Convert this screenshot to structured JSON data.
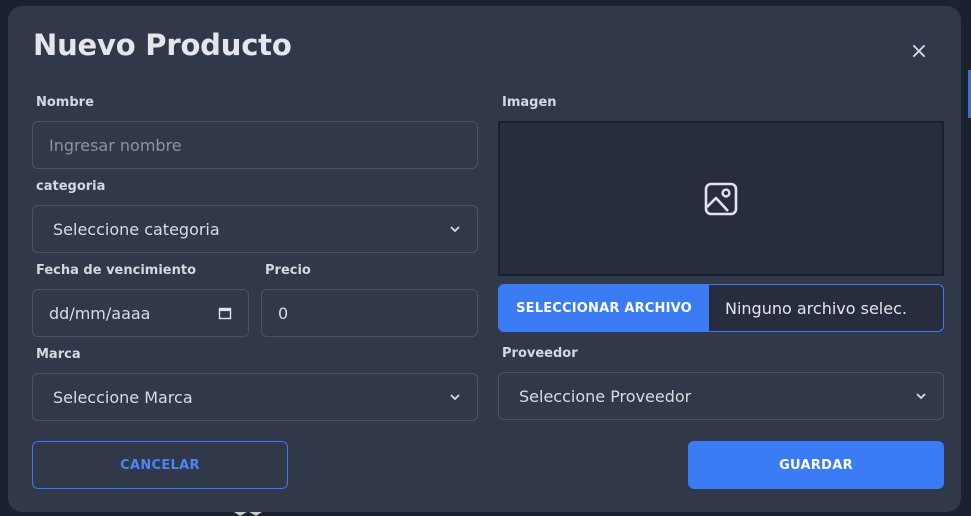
{
  "modal": {
    "title": "Nuevo Producto",
    "close_label": "×"
  },
  "form": {
    "nombre": {
      "label": "Nombre",
      "placeholder": "Ingresar nombre",
      "value": ""
    },
    "categoria": {
      "label": "categoria",
      "selected": "Seleccione categoria"
    },
    "fecha_vencimiento": {
      "label": "Fecha de vencimiento",
      "value": "dd/mm/aaaa"
    },
    "precio": {
      "label": "Precio",
      "value": "0"
    },
    "marca": {
      "label": "Marca",
      "selected": "Seleccione Marca"
    },
    "imagen": {
      "label": "Imagen",
      "file_button": "SELECCIONAR ARCHIVO",
      "file_name": "Ninguno archivo selec."
    },
    "proveedor": {
      "label": "Proveedor",
      "selected": "Seleccione Proveedor"
    }
  },
  "actions": {
    "cancel": "CANCELAR",
    "save": "GUARDAR"
  },
  "colors": {
    "background": "#30384a",
    "accent": "#3b7cf4",
    "field_border": "#4b5366",
    "text": "#e4e6ec"
  },
  "icons": {
    "close": "close-icon",
    "image_placeholder": "image-icon",
    "calendar": "calendar-icon",
    "select_chevron": "chevron-down-icon"
  }
}
